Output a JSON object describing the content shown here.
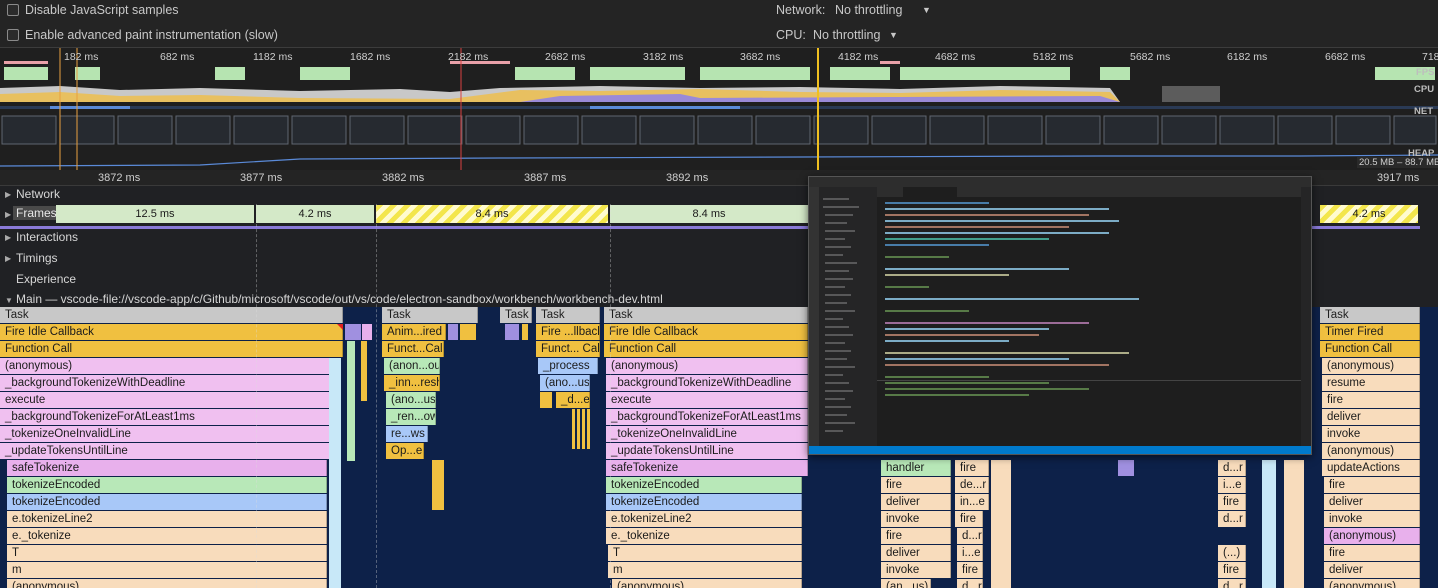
{
  "settings": {
    "disable_js_samples": "Disable JavaScript samples",
    "advanced_paint": "Enable advanced paint instrumentation (slow)",
    "network_label": "Network:",
    "network_value": "No throttling",
    "cpu_label": "CPU:",
    "cpu_value": "No throttling"
  },
  "overview": {
    "ticks": [
      "182 ms",
      "682 ms",
      "1182 ms",
      "1682 ms",
      "2182 ms",
      "2682 ms",
      "3182 ms",
      "3682 ms",
      "4182 ms",
      "4682 ms",
      "5182 ms",
      "5682 ms",
      "6182 ms",
      "6682 ms",
      "718"
    ],
    "labels": {
      "fps": "FPS",
      "cpu": "CPU",
      "net": "NET",
      "heap": "HEAP"
    },
    "heap_range": "20.5 MB – 88.7 MB"
  },
  "ruler": {
    "ticks": [
      "3872 ms",
      "3877 ms",
      "3882 ms",
      "3887 ms",
      "3892 ms",
      "3917 ms"
    ]
  },
  "tracks": {
    "network": "Network",
    "frames": "Frames",
    "interactions": "Interactions",
    "timings": "Timings",
    "experience": "Experience",
    "main": "Main — vscode-file://vscode-app/c/Github/microsoft/vscode/out/vs/code/electron-sandbox/workbench/workbench-dev.html"
  },
  "frames": [
    "12.5 ms",
    "4.2 ms",
    "8.4 ms",
    "8.4 ms",
    "4.2 ms"
  ],
  "flame": {
    "col_a": [
      "Task",
      "Fire Idle Callback",
      "Function Call",
      "(anonymous)",
      "_backgroundTokenizeWithDeadline",
      "execute",
      "_backgroundTokenizeForAtLeast1ms",
      "_tokenizeOneInvalidLine",
      "_updateTokensUntilLine",
      "safeTokenize",
      "tokenizeEncoded",
      "tokenizeEncoded",
      "e.tokenizeLine2",
      "e._tokenize",
      "T",
      "m",
      "(anonymous)"
    ],
    "col_b": [
      "Task",
      "Anim...ired",
      "Funct...Call",
      "(anon...ous)",
      "_inn...resh",
      "(ano...us)",
      "_ren...ows",
      "re...ws",
      "Op...e"
    ],
    "col_c": [
      "Task"
    ],
    "col_d": [
      "Task",
      "Fire ...llback",
      "Funct... Call",
      "_process",
      "(ano...us)",
      "_d...e"
    ],
    "col_e": [
      "Task",
      "Fire Idle Callback",
      "Function Call",
      "(anonymous)",
      "_backgroundTokenizeWithDeadline",
      "execute",
      "_backgroundTokenizeForAtLeast1ms",
      "_tokenizeOneInvalidLine",
      "_updateTokensUntilLine",
      "safeTokenize",
      "tokenizeEncoded",
      "tokenizeEncoded",
      "e.tokenizeLine2",
      "e._tokenize",
      "T",
      "m",
      "(anonymous)"
    ],
    "col_f": [
      "handler",
      "fire",
      "deliver",
      "invoke",
      "fire",
      "deliver",
      "invoke",
      "(an...us)"
    ],
    "col_g": [
      "fire",
      "de...r",
      "in...e",
      "fire",
      "d...r",
      "i...e",
      "fire",
      "d...r"
    ],
    "col_h": [
      "d...r",
      "i...e",
      "fire",
      "d...r",
      "(...)",
      "fire",
      "d...r"
    ],
    "col_i": [
      "Task",
      "Timer Fired",
      "Function Call",
      "(anonymous)",
      "resume",
      "fire",
      "deliver",
      "invoke",
      "(anonymous)",
      "updateActions",
      "fire",
      "deliver",
      "invoke",
      "(anonymous)",
      "fire",
      "deliver",
      "(anonymous)"
    ]
  }
}
